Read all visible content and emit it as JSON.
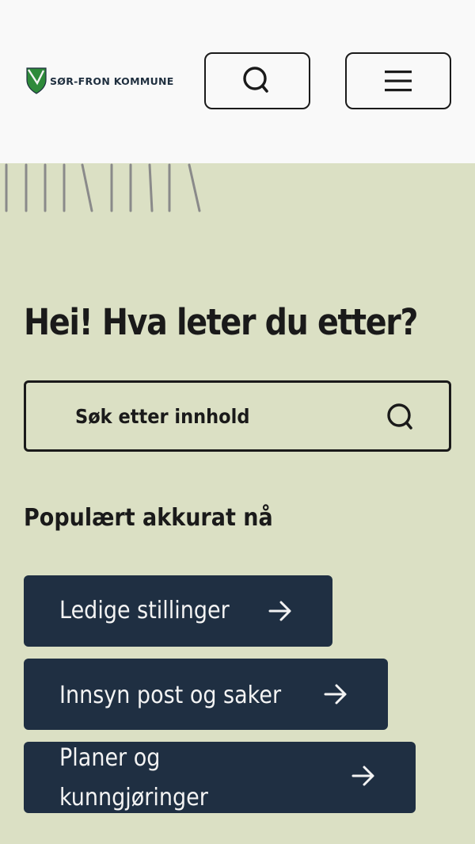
{
  "header": {
    "logo_text": "SØR-FRON KOMMUNE",
    "search_button_label": "Søk",
    "menu_button_label": "Meny"
  },
  "hero": {
    "headline": "Hei! Hva leter du etter?"
  },
  "search": {
    "placeholder": "Søk etter innhold"
  },
  "popular": {
    "heading": "Populært akkurat nå",
    "links": [
      {
        "label": "Ledige stillinger"
      },
      {
        "label": "Innsyn post og saker"
      },
      {
        "label": "Planer og kunngjøringer"
      }
    ]
  },
  "icons": {
    "search": "search-icon",
    "menu": "hamburger-menu-icon",
    "arrow": "arrow-right-icon",
    "crest": "municipality-crest-icon"
  },
  "colors": {
    "header_bg": "#f9f9f9",
    "page_bg": "#dbe0c4",
    "link_bg": "#1f2f42",
    "link_text": "#f3f3f3",
    "crest_green": "#2e8a3a",
    "decor_lines": "#8a8a8a"
  }
}
